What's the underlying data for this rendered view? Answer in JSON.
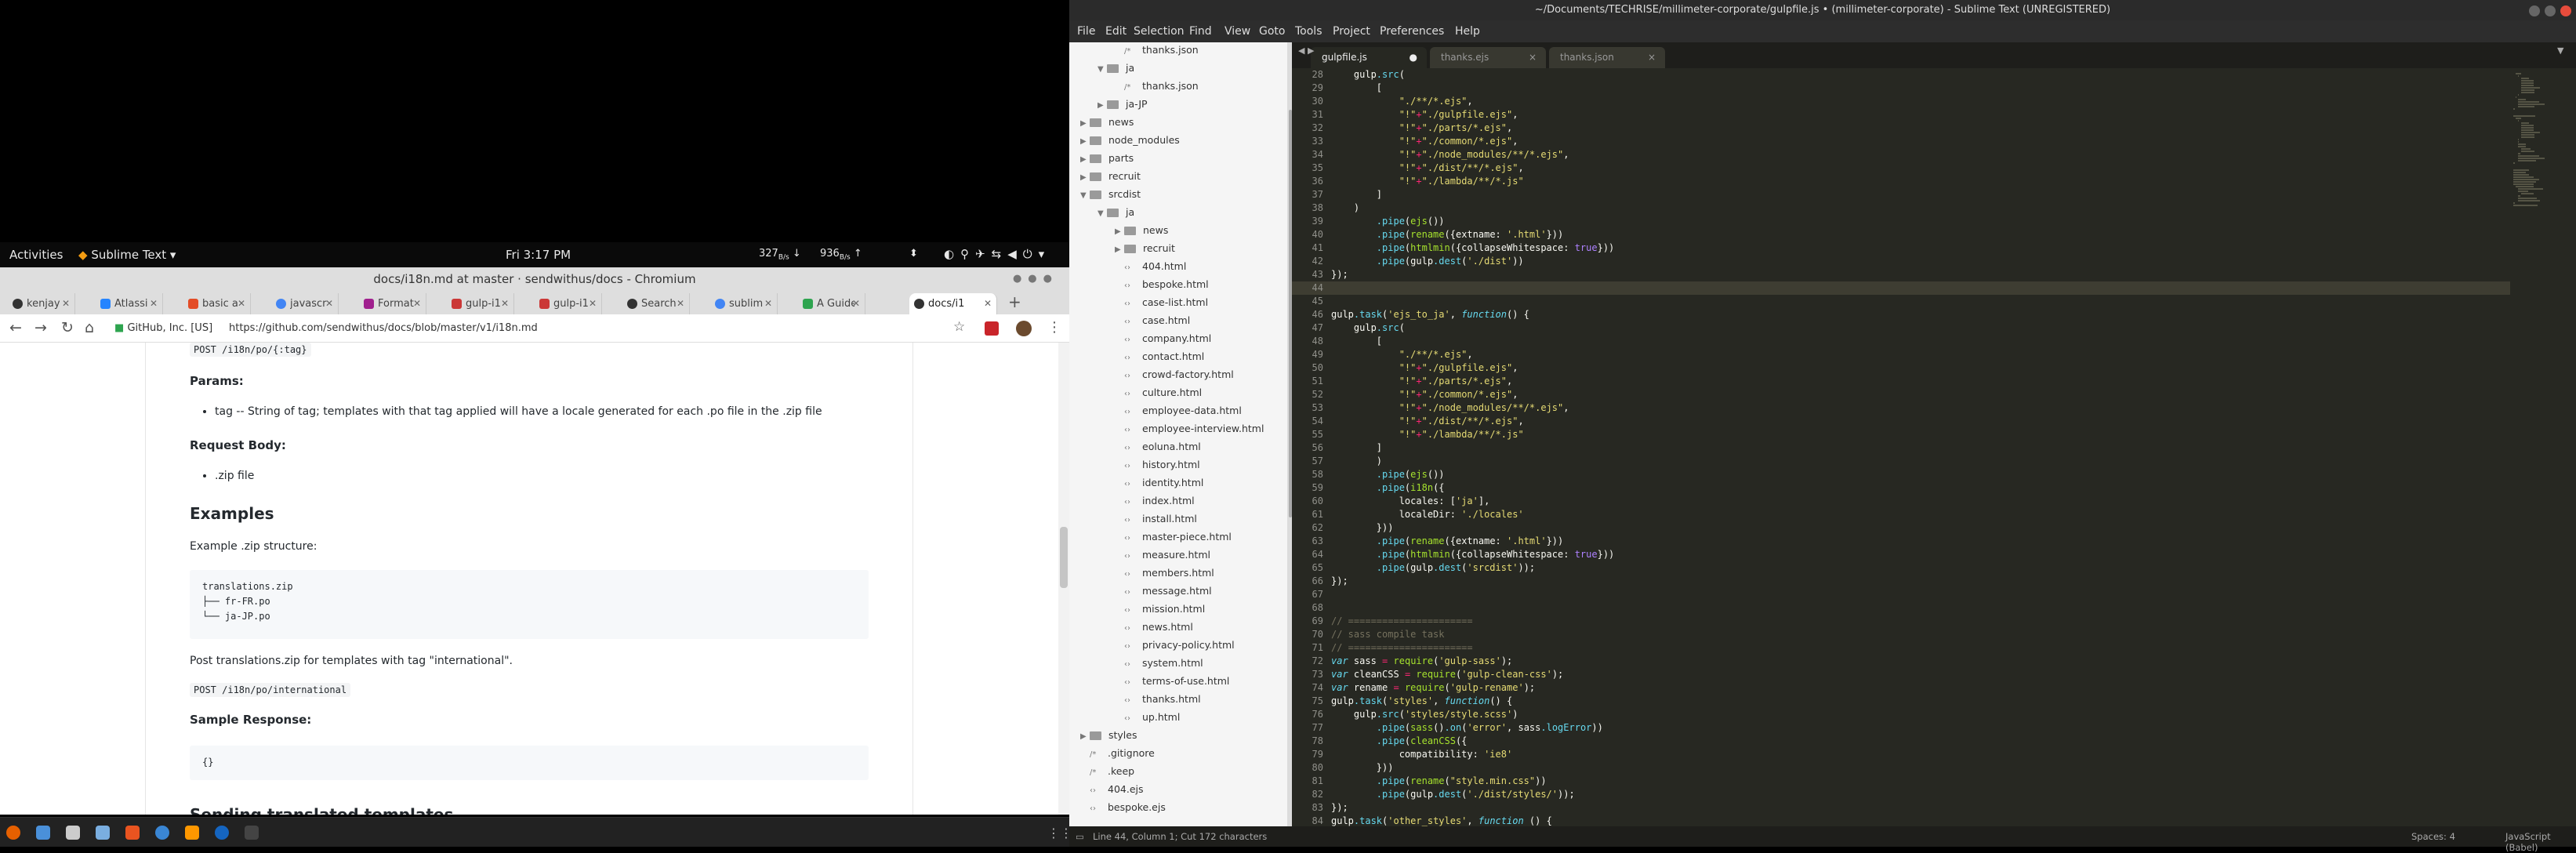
{
  "gnome": {
    "activities": "Activities",
    "app_menu": "Sublime Text ▾",
    "clock": "Fri 3:17 PM",
    "kb_down": "327",
    "kb_down_unit": "B/s",
    "kb_up": "936",
    "kb_up_unit": "B/s"
  },
  "chromium": {
    "window_title": "docs/i18n.md at master · sendwithus/docs - Chromium",
    "tabs": [
      "kenjay",
      "Atlassi",
      "basic a",
      "javascr",
      "Format",
      "gulp-i1",
      "gulp-i1",
      "Search",
      "sublim",
      "A Guide",
      "docs/i1"
    ],
    "address_security": "GitHub, Inc. [US]",
    "address_url": "https://github.com/sendwithus/docs/blob/master/v1/i18n.md"
  },
  "doc": {
    "top_code": "POST /i18n/po/{:tag}",
    "params_heading": "Params:",
    "param_item": "tag -- String of tag; templates with that tag applied will have a locale generated for each .po file in the .zip file",
    "request_body_heading": "Request Body:",
    "request_body_item": ".zip file",
    "examples_heading": "Examples",
    "example_desc": "Example .zip structure:",
    "zip_structure": "translations.zip\n├── fr-FR.po\n└── ja-JP.po",
    "post_desc": "Post translations.zip for templates with tag \"international\".",
    "post_code": "POST /i18n/po/international",
    "sample_response_heading": "Sample Response:",
    "sample_response": "{}",
    "next_heading": "Sending translated templates"
  },
  "sublime": {
    "window_title": "~/Documents/TECHRISE/millimeter-corporate/gulpfile.js • (millimeter-corporate) - Sublime Text (UNREGISTERED)",
    "menu": [
      "File",
      "Edit",
      "Selection",
      "Find",
      "View",
      "Goto",
      "Tools",
      "Project",
      "Preferences",
      "Help"
    ],
    "tabs": [
      {
        "label": "gulpfile.js",
        "close": "●"
      },
      {
        "label": "thanks.ejs",
        "close": "×"
      },
      {
        "label": "thanks.json",
        "close": "×"
      }
    ],
    "status_left": "Line 44, Column 1; Cut 172 characters",
    "status_spaces": "Spaces: 4",
    "status_syntax": "JavaScript (Babel)"
  },
  "sidebar_items": [
    {
      "label": "thanks.json",
      "kind": "file",
      "indent": 2
    },
    {
      "label": "ja",
      "kind": "folder-open",
      "indent": 1
    },
    {
      "label": "thanks.json",
      "kind": "file",
      "indent": 2
    },
    {
      "label": "ja-JP",
      "kind": "folder",
      "indent": 1
    },
    {
      "label": "news",
      "kind": "folder",
      "indent": 0
    },
    {
      "label": "node_modules",
      "kind": "folder",
      "indent": 0
    },
    {
      "label": "parts",
      "kind": "folder",
      "indent": 0
    },
    {
      "label": "recruit",
      "kind": "folder",
      "indent": 0
    },
    {
      "label": "srcdist",
      "kind": "folder-open",
      "indent": 0
    },
    {
      "label": "ja",
      "kind": "folder-open",
      "indent": 1
    },
    {
      "label": "news",
      "kind": "folder",
      "indent": 2
    },
    {
      "label": "recruit",
      "kind": "folder",
      "indent": 2
    },
    {
      "label": "404.html",
      "kind": "code",
      "indent": 2
    },
    {
      "label": "bespoke.html",
      "kind": "code",
      "indent": 2
    },
    {
      "label": "case-list.html",
      "kind": "code",
      "indent": 2
    },
    {
      "label": "case.html",
      "kind": "code",
      "indent": 2
    },
    {
      "label": "company.html",
      "kind": "code",
      "indent": 2
    },
    {
      "label": "contact.html",
      "kind": "code",
      "indent": 2
    },
    {
      "label": "crowd-factory.html",
      "kind": "code",
      "indent": 2
    },
    {
      "label": "culture.html",
      "kind": "code",
      "indent": 2
    },
    {
      "label": "employee-data.html",
      "kind": "code",
      "indent": 2
    },
    {
      "label": "employee-interview.html",
      "kind": "code",
      "indent": 2
    },
    {
      "label": "eoluna.html",
      "kind": "code",
      "indent": 2
    },
    {
      "label": "history.html",
      "kind": "code",
      "indent": 2
    },
    {
      "label": "identity.html",
      "kind": "code",
      "indent": 2
    },
    {
      "label": "index.html",
      "kind": "code",
      "indent": 2
    },
    {
      "label": "install.html",
      "kind": "code",
      "indent": 2
    },
    {
      "label": "master-piece.html",
      "kind": "code",
      "indent": 2
    },
    {
      "label": "measure.html",
      "kind": "code",
      "indent": 2
    },
    {
      "label": "members.html",
      "kind": "code",
      "indent": 2
    },
    {
      "label": "message.html",
      "kind": "code",
      "indent": 2
    },
    {
      "label": "mission.html",
      "kind": "code",
      "indent": 2
    },
    {
      "label": "news.html",
      "kind": "code",
      "indent": 2
    },
    {
      "label": "privacy-policy.html",
      "kind": "code",
      "indent": 2
    },
    {
      "label": "system.html",
      "kind": "code",
      "indent": 2
    },
    {
      "label": "terms-of-use.html",
      "kind": "code",
      "indent": 2
    },
    {
      "label": "thanks.html",
      "kind": "code",
      "indent": 2
    },
    {
      "label": "up.html",
      "kind": "code",
      "indent": 2
    },
    {
      "label": "styles",
      "kind": "folder",
      "indent": 0
    },
    {
      "label": ".gitignore",
      "kind": "file",
      "indent": 0
    },
    {
      "label": ".keep",
      "kind": "file",
      "indent": 0
    },
    {
      "label": "404.ejs",
      "kind": "code",
      "indent": 0
    },
    {
      "label": "bespoke.ejs",
      "kind": "code",
      "indent": 0
    }
  ],
  "code_start_line": 28,
  "current_line": 44,
  "code_lines": [
    "    gulp.src(",
    "        [",
    "            \"./**/*.ejs\",",
    "            \"!\"+\"./gulpfile.ejs\",",
    "            \"!\"+\"./parts/*.ejs\",",
    "            \"!\"+\"./common/*.ejs\",",
    "            \"!\"+\"./node_modules/**/*.ejs\",",
    "            \"!\"+\"./dist/**/*.ejs\",",
    "            \"!\"+\"./lambda/**/*.js\"",
    "        ]",
    "    )",
    "        .pipe(ejs())",
    "        .pipe(rename({extname: '.html'}))",
    "        .pipe(htmlmin({collapseWhitespace: true}))",
    "        .pipe(gulp.dest('./dist'))",
    "});",
    "",
    "",
    "gulp.task('ejs_to_ja', function() {",
    "    gulp.src(",
    "        [",
    "            \"./**/*.ejs\",",
    "            \"!\"+\"./gulpfile.ejs\",",
    "            \"!\"+\"./parts/*.ejs\",",
    "            \"!\"+\"./common/*.ejs\",",
    "            \"!\"+\"./node_modules/**/*.ejs\",",
    "            \"!\"+\"./dist/**/*.ejs\",",
    "            \"!\"+\"./lambda/**/*.js\"",
    "        ]",
    "        )",
    "        .pipe(ejs())",
    "        .pipe(i18n({",
    "            locales: ['ja'],",
    "            localeDir: './locales'",
    "        }))",
    "        .pipe(rename({extname: '.html'}))",
    "        .pipe(htmlmin({collapseWhitespace: true}))",
    "        .pipe(gulp.dest('srcdist'));",
    "});",
    "",
    "",
    "// ======================",
    "// sass compile task",
    "// ======================",
    "var sass = require('gulp-sass');",
    "var cleanCSS = require('gulp-clean-css');",
    "var rename = require('gulp-rename');",
    "gulp.task('styles', function() {",
    "    gulp.src('styles/style.scss')",
    "        .pipe(sass().on('error', sass.logError))",
    "        .pipe(cleanCSS({",
    "            compatibility: 'ie8'",
    "        }))",
    "        .pipe(rename(\"style.min.css\"))",
    "        .pipe(gulp.dest('./dist/styles/'));",
    "});",
    "gulp.task('other_styles', function () {"
  ]
}
